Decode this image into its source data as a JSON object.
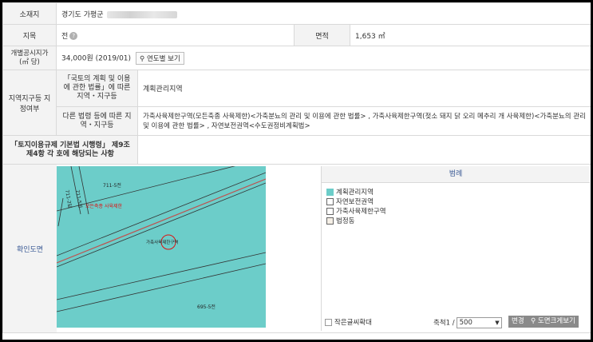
{
  "row_location": {
    "label": "소재지",
    "value": "경기도 가평군"
  },
  "row_land": {
    "label_jimok": "지목",
    "jimok_value": "전",
    "help_icon": "question-icon",
    "label_area": "면적",
    "area_value": "1,653 ㎡"
  },
  "row_price": {
    "label": "개별공시지가(㎡ 당)",
    "value": "34,000원 (2019/01)",
    "year_button": "연도별 보기"
  },
  "zoning": {
    "label": "지역지구등 지정여부",
    "sub1_label": "「국토의 계획 및 이용에 관한 법률」에 따른 지역・지구등",
    "sub1_value": "계획관리지역",
    "sub2_label": "다른 법령 등에 따른 지역・지구등",
    "sub2_value": "가축사육제한구역(모든축종 사육제한)<가축분뇨의 관리 및 이용에 관한 법률> , 가축사육제한구역(젖소 돼지 닭 오리 메추리 개 사육제한)<가축분뇨의 관리 및 이용에 관한 법률> , 자연보전권역<수도권정비계획법>"
  },
  "row_rules": {
    "label": "「토지이용규제 기본법 시행령」 제9조제4항 각 호에 해당되는 사항",
    "value": ""
  },
  "map_section": {
    "label": "확인도면",
    "parcels": [
      "711-5전",
      "711-2답",
      "711-5전",
      "695-5전"
    ],
    "parcel_label": "가축사육제한구역",
    "red_text": "모든축종 사육제한",
    "legend_title": "범례",
    "legend_items": [
      {
        "label": "계획관리지역",
        "color": "#6ccdc9"
      },
      {
        "label": "자연보전권역",
        "color": "#ffffff"
      },
      {
        "label": "가축사육제한구역",
        "color": "#ffffff"
      },
      {
        "label": "법정동",
        "color": "#f5efe6"
      }
    ],
    "small_text_zoom": "작은글씨확대",
    "scale_label": "축척1 /",
    "scale_value": "500",
    "change_button": "변경",
    "zoom_button": "도면크게보기"
  }
}
